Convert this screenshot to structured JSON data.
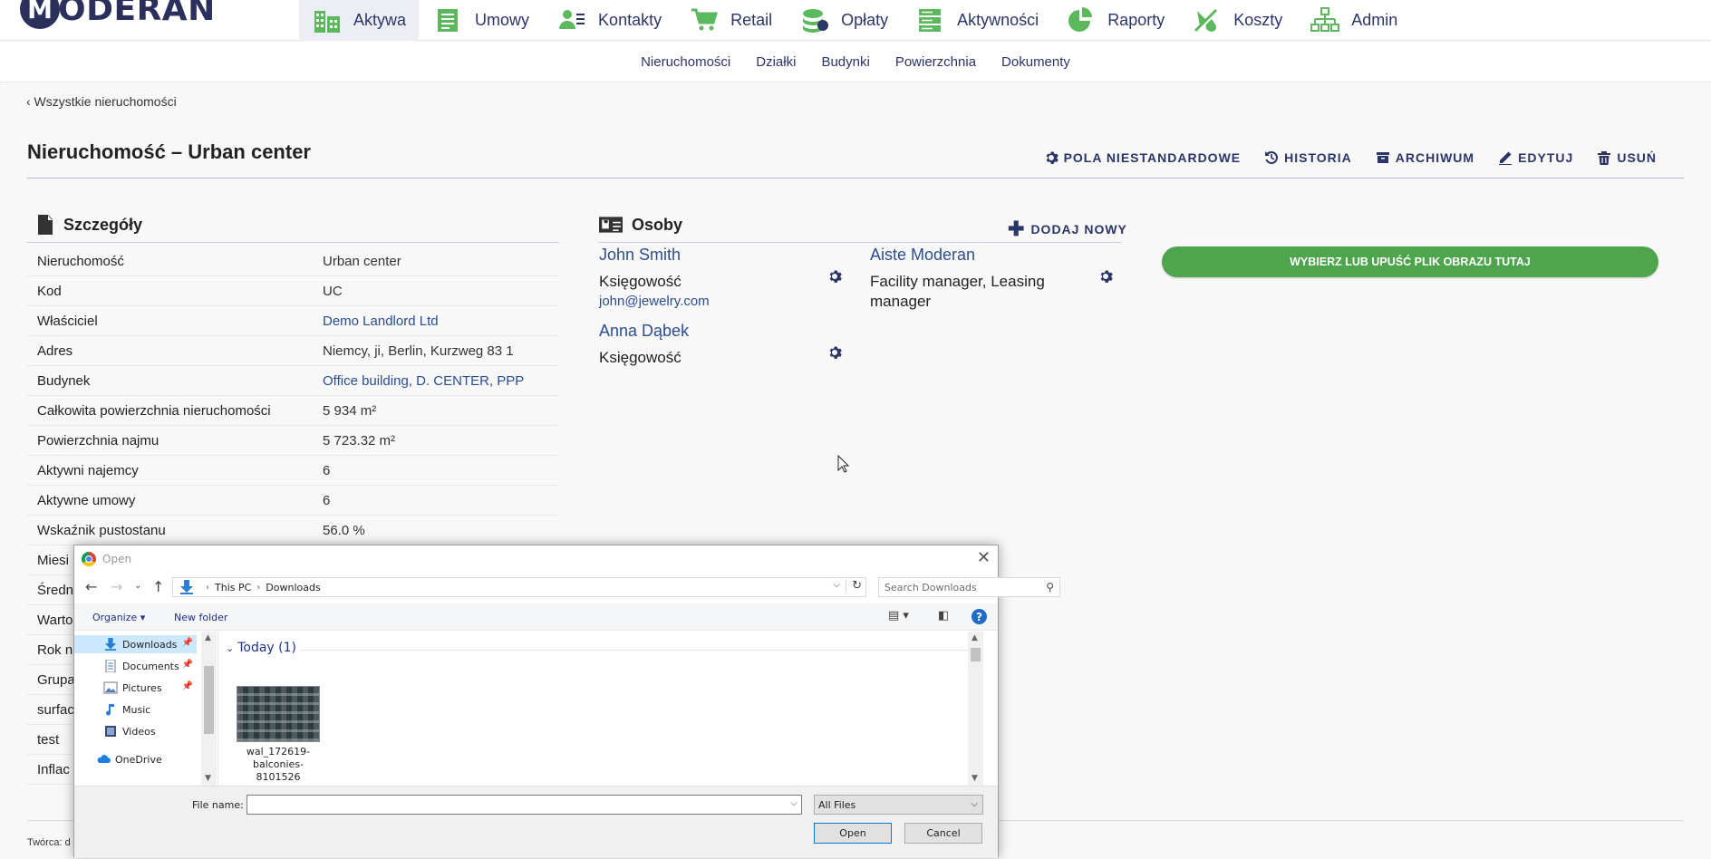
{
  "app": {
    "logo_letter": "M",
    "logo_text": "ODERAN"
  },
  "nav": [
    {
      "label": "Aktywa",
      "icon": "buildings-icon",
      "active": true
    },
    {
      "label": "Umowy",
      "icon": "document-icon"
    },
    {
      "label": "Kontakty",
      "icon": "contacts-icon"
    },
    {
      "label": "Retail",
      "icon": "cart-icon"
    },
    {
      "label": "Opłaty",
      "icon": "coins-icon"
    },
    {
      "label": "Aktywności",
      "icon": "list-icon"
    },
    {
      "label": "Raporty",
      "icon": "piechart-icon"
    },
    {
      "label": "Koszty",
      "icon": "costs-icon"
    },
    {
      "label": "Admin",
      "icon": "org-chart-icon"
    }
  ],
  "subnav": [
    "Nieruchomości",
    "Działki",
    "Budynki",
    "Powierzchnia",
    "Dokumenty"
  ],
  "back_link": "‹ Wszystkie nieruchomości",
  "page_title": "Nieruchomość – Urban center",
  "actions": {
    "custom_fields": "POLA NIESTANDARDOWE",
    "history": "HISTORIA",
    "archive": "ARCHIWUM",
    "edit": "EDYTUJ",
    "delete": "USUŃ"
  },
  "details": {
    "title": "Szczegóły",
    "rows": [
      {
        "label": "Nieruchomość",
        "value": "Urban center"
      },
      {
        "label": "Kod",
        "value": "UC"
      },
      {
        "label": "Właściciel",
        "value": "Demo Landlord Ltd",
        "link": true
      },
      {
        "label": "Adres",
        "value": "Niemcy, ji, Berlin, Kurzweg 83 1"
      },
      {
        "label": "Budynek",
        "value": "Office building, D. CENTER, PPP",
        "link": true
      },
      {
        "label": "Całkowita powierzchnia nieruchomości",
        "value": "5 934 m²"
      },
      {
        "label": "Powierzchnia najmu",
        "value": "5 723.32 m²"
      },
      {
        "label": "Aktywni najemcy",
        "value": "6"
      },
      {
        "label": "Aktywne umowy",
        "value": "6"
      },
      {
        "label": "Wskaźnik pustostanu",
        "value": "56.0 %"
      },
      {
        "label": "Miesi",
        "value": ""
      },
      {
        "label": "Średn",
        "value": ""
      },
      {
        "label": "Warto",
        "value": ""
      },
      {
        "label": "Rok n",
        "value": ""
      },
      {
        "label": "Grupa",
        "value": ""
      },
      {
        "label": "surfac",
        "value": ""
      },
      {
        "label": "test",
        "value": ""
      },
      {
        "label": "Inflac",
        "value": ""
      }
    ]
  },
  "persons": {
    "title": "Osoby",
    "add_new": "DODAJ NOWY",
    "list": [
      {
        "name": "John Smith",
        "role": "Księgowość",
        "email": "john@jewelry.com"
      },
      {
        "name": "Aiste Moderan",
        "role": "Facility manager, Leasing manager",
        "email": ""
      },
      {
        "name": "Anna Dąbek",
        "role": "Księgowość",
        "email": ""
      }
    ]
  },
  "upload_button": "WYBIERZ LUB UPUŚĆ PLIK OBRAZU TUTAJ",
  "footer": "Twórca: d",
  "dialog": {
    "title": "Open",
    "breadcrumb": [
      "This PC",
      "Downloads"
    ],
    "search_placeholder": "Search Downloads",
    "organize": "Organize ▾",
    "new_folder": "New folder",
    "nav_items": [
      {
        "label": "Downloads",
        "icon": "download-icon",
        "pinned": true,
        "selected": true
      },
      {
        "label": "Documents",
        "icon": "documents-icon",
        "pinned": true
      },
      {
        "label": "Pictures",
        "icon": "pictures-icon",
        "pinned": true
      },
      {
        "label": "Music",
        "icon": "music-icon"
      },
      {
        "label": "Videos",
        "icon": "videos-icon"
      },
      {
        "label": "OneDrive",
        "icon": "onedrive-icon"
      }
    ],
    "group_label": "Today (1)",
    "file_name": "wal_172619-balconies-8101526",
    "file_name_label": "File name:",
    "file_name_value": "",
    "file_type": "All Files",
    "open_button": "Open",
    "cancel_button": "Cancel"
  }
}
